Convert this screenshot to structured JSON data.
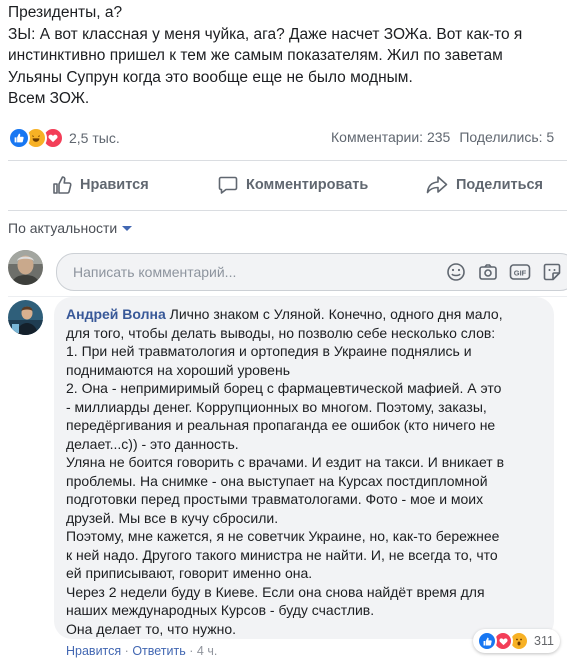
{
  "post": {
    "lines": [
      "Президенты, а?",
      "ЗЫ: А вот классная у меня чуйка, ага? Даже насчет ЗОЖа. Вот как-то я",
      "инстинктивно пришел к тем же самым показателям. Жил по заветам",
      "Ульяны Супрун когда это вообще еще не было модным.",
      "Всем ЗОЖ."
    ]
  },
  "summary": {
    "reaction_icons": [
      "like-icon",
      "haha-icon",
      "love-icon"
    ],
    "reaction_count": "2,5 тыс.",
    "comments": "Комментарии: 235",
    "shares": "Поделились: 5"
  },
  "actions": {
    "like": "Нравится",
    "comment": "Комментировать",
    "share": "Поделиться"
  },
  "sort": {
    "label": "По актуальности"
  },
  "composer": {
    "placeholder": "Написать комментарий...",
    "icons": [
      "emoji-icon",
      "camera-icon",
      "gif-icon",
      "sticker-icon"
    ]
  },
  "comment": {
    "author": "Андрей Волна",
    "first_line": "Лично знаком с Уляной. Конечно, одного дня мало,",
    "lines": [
      "для того, чтобы делать выводы, но позволю себе несколько слов:",
      "1. При ней травматология и ортопедия в Украине поднялись и",
      "поднимаются на хороший уровень",
      "2. Она - непримиримый борец с фармацевтической мафией. А это",
      "- миллиарды денег. Коррупционных во многом. Поэтому, заказы,",
      "передёргивания и реальная пропаганда ее ошибок (кто ничего не",
      "делает...с)) - это данность.",
      "Уляна не боится говорить с врачами. И ездит на такси. И вникает в",
      "проблемы. На снимке - она выступает на Курсах постдипломной",
      "подготовки перед простыми травматологами. Фото - мое и моих",
      "друзей. Мы все в кучу сбросили.",
      "Поэтому, мне кажется, я не советчик Украине, но, как-то бережнее",
      "к ней надо. Другого такого министра не найти. И, не всегда то, что",
      "ей приписывают, говорит именно она.",
      "Через 2 недели буду в Киеве. Если она снова найдёт время для",
      "наших международных Курсов - буду счастлив.",
      "Она делает то, что нужно."
    ],
    "reactions": [
      "like-icon",
      "love-icon",
      "wow-icon"
    ],
    "reaction_count": "311",
    "like_link": "Нравится",
    "dot": "·",
    "reply_link": "Ответить",
    "time": "4 ч."
  },
  "colors": {
    "accent": "#385898",
    "like": "#1877f2",
    "love": "#f33e58",
    "haha": "#f7b125",
    "bubble": "#f2f3f5"
  }
}
